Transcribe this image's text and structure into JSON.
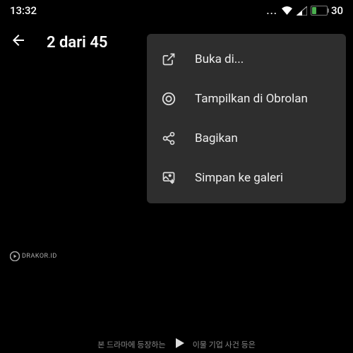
{
  "status": {
    "time": "13:32",
    "battery": "30"
  },
  "header": {
    "title": "2 dari 45"
  },
  "menu": {
    "items": [
      {
        "label": "Buka di..."
      },
      {
        "label": "Tampilkan di Obrolan"
      },
      {
        "label": "Bagikan"
      },
      {
        "label": "Simpan ke galeri"
      }
    ]
  },
  "watermark": {
    "text": "DRAKOR.ID"
  },
  "bottom": {
    "text_left": "본 드라마에 등장하는",
    "text_right": "이물 기업 사건 등은"
  }
}
